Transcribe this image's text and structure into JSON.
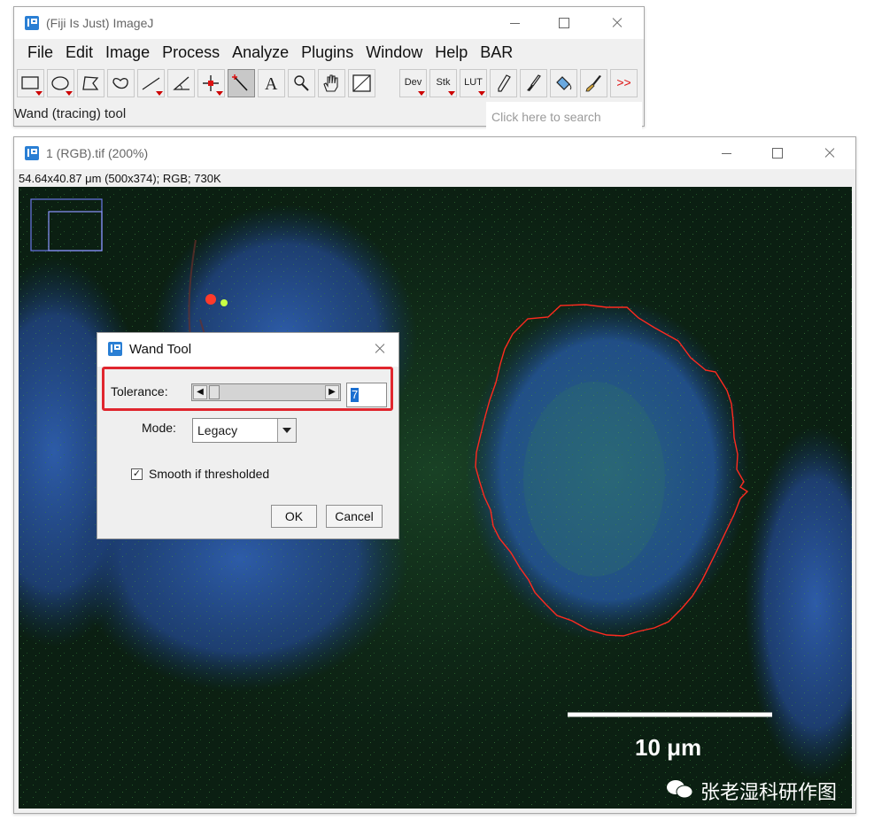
{
  "main_window": {
    "title": "(Fiji Is Just) ImageJ",
    "menu": [
      "File",
      "Edit",
      "Image",
      "Process",
      "Analyze",
      "Plugins",
      "Window",
      "Help",
      "BAR"
    ],
    "tools": [
      {
        "name": "rectangle-tool"
      },
      {
        "name": "oval-tool"
      },
      {
        "name": "polygon-tool"
      },
      {
        "name": "freehand-tool"
      },
      {
        "name": "line-tool"
      },
      {
        "name": "angle-tool"
      },
      {
        "name": "point-tool"
      },
      {
        "name": "wand-tool",
        "active": true
      },
      {
        "name": "text-tool"
      },
      {
        "name": "magnifier-tool"
      },
      {
        "name": "hand-tool"
      },
      {
        "name": "color-picker-tool"
      }
    ],
    "menu_buttons": {
      "dev": "Dev",
      "stk": "Stk",
      "lut": "LUT",
      "more": ">>"
    },
    "status": "Wand (tracing) tool",
    "search_placeholder": "Click here to search"
  },
  "image_window": {
    "title": "1 (RGB).tif (200%)",
    "info": "54.64x40.87 μm (500x374); RGB; 730K",
    "scale_bar_label": "10 μm",
    "watermark": "张老湿科研作图"
  },
  "dialog": {
    "title": "Wand Tool",
    "tolerance_label": "Tolerance:",
    "tolerance_value": "7",
    "mode_label": "Mode:",
    "mode_value": "Legacy",
    "smooth_label": "Smooth if thresholded",
    "smooth_checked": true,
    "ok": "OK",
    "cancel": "Cancel"
  },
  "colors": {
    "highlight": "#e0262e",
    "roi": "#ff2a1f",
    "accent": "#2a7fd4"
  }
}
